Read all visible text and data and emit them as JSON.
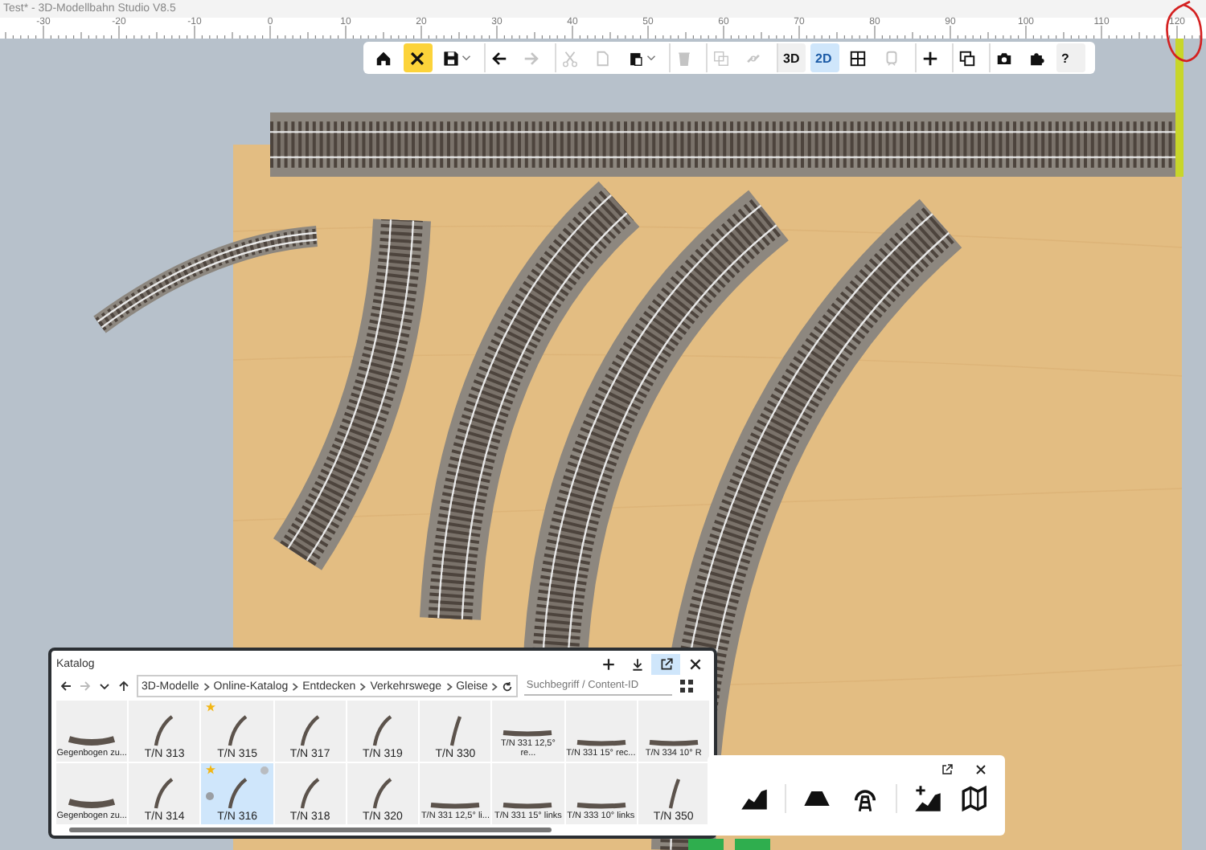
{
  "window": {
    "title": "Test* - 3D-Modellbahn Studio V8.5"
  },
  "ruler": {
    "labels": [
      "-30",
      "-20",
      "-10",
      "0",
      "10",
      "20",
      "30",
      "40",
      "50",
      "60",
      "70",
      "80",
      "90",
      "100",
      "110",
      "120"
    ]
  },
  "toolbar": [
    {
      "kind": "home",
      "selected": false,
      "disabled": false,
      "dropdown": false,
      "separator": false
    },
    {
      "kind": "tools",
      "selected": true,
      "disabled": false,
      "dropdown": false,
      "separator": false
    },
    {
      "kind": "save",
      "selected": false,
      "disabled": false,
      "dropdown": true,
      "separator": false
    },
    {
      "kind": "undo",
      "selected": false,
      "disabled": false,
      "dropdown": false,
      "separator": true
    },
    {
      "kind": "redo",
      "selected": false,
      "disabled": true,
      "dropdown": false,
      "separator": false
    },
    {
      "kind": "cut",
      "selected": false,
      "disabled": true,
      "dropdown": false,
      "separator": true
    },
    {
      "kind": "copy",
      "selected": false,
      "disabled": true,
      "dropdown": false,
      "separator": false
    },
    {
      "kind": "paste",
      "selected": false,
      "disabled": false,
      "dropdown": true,
      "separator": false
    },
    {
      "kind": "delete",
      "selected": false,
      "disabled": true,
      "dropdown": false,
      "separator": true
    },
    {
      "kind": "group",
      "selected": false,
      "disabled": true,
      "dropdown": false,
      "separator": true
    },
    {
      "kind": "link",
      "selected": false,
      "disabled": true,
      "dropdown": false,
      "separator": false
    },
    {
      "kind": "text",
      "label": "3D",
      "selected": false,
      "disabled": false,
      "dropdown": false,
      "separator": true
    },
    {
      "kind": "text",
      "label": "2D",
      "selected": true,
      "disabled": false,
      "dropdown": false,
      "separator": false
    },
    {
      "kind": "grid",
      "selected": false,
      "disabled": false,
      "dropdown": false,
      "separator": false
    },
    {
      "kind": "train",
      "selected": false,
      "disabled": true,
      "dropdown": false,
      "separator": false
    },
    {
      "kind": "plus",
      "selected": false,
      "disabled": false,
      "dropdown": false,
      "separator": true
    },
    {
      "kind": "windows",
      "selected": false,
      "disabled": false,
      "dropdown": false,
      "separator": true
    },
    {
      "kind": "camera",
      "selected": false,
      "disabled": false,
      "dropdown": false,
      "separator": true
    },
    {
      "kind": "puzzle",
      "selected": false,
      "disabled": false,
      "dropdown": false,
      "separator": false
    },
    {
      "kind": "text",
      "label": "?",
      "selected": false,
      "disabled": false,
      "dropdown": false,
      "separator": false
    }
  ],
  "catalog": {
    "title": "Katalog",
    "header_buttons": [
      {
        "kind": "plus",
        "selected": false
      },
      {
        "kind": "download",
        "selected": false
      },
      {
        "kind": "popout",
        "selected": true
      },
      {
        "kind": "close",
        "selected": false
      }
    ],
    "nav": [
      {
        "kind": "back",
        "disabled": false
      },
      {
        "kind": "forward",
        "disabled": true
      },
      {
        "kind": "down",
        "disabled": false
      },
      {
        "kind": "up",
        "disabled": false
      }
    ],
    "breadcrumb": [
      "3D-Modelle",
      "Online-Katalog",
      "Entdecken",
      "Verkehrswege",
      "Gleise"
    ],
    "search": {
      "placeholder": "Suchbegriff / Content-ID"
    },
    "items": [
      {
        "label": "Gegenbogen zu...",
        "kind": "wide",
        "selected": false,
        "favorite": false,
        "markers": false
      },
      {
        "label": "T/N 313",
        "kind": "curve",
        "selected": false,
        "favorite": false,
        "markers": false
      },
      {
        "label": "T/N 315",
        "kind": "curve",
        "selected": false,
        "favorite": true,
        "markers": false
      },
      {
        "label": "T/N 317",
        "kind": "curve",
        "selected": false,
        "favorite": false,
        "markers": false
      },
      {
        "label": "T/N 319",
        "kind": "curve",
        "selected": false,
        "favorite": false,
        "markers": false
      },
      {
        "label": "T/N 330",
        "kind": "steep",
        "selected": false,
        "favorite": false,
        "markers": false
      },
      {
        "label": "T/N 331 12,5° re...",
        "kind": "flat",
        "selected": false,
        "favorite": false,
        "markers": false
      },
      {
        "label": "T/N 331 15° rec...",
        "kind": "flat",
        "selected": false,
        "favorite": false,
        "markers": false
      },
      {
        "label": "T/N 334 10° R",
        "kind": "flat",
        "selected": false,
        "favorite": false,
        "markers": false
      },
      {
        "label": "Gegenbogen zu...",
        "kind": "wide",
        "selected": false,
        "favorite": false,
        "markers": false
      },
      {
        "label": "T/N 314",
        "kind": "curve",
        "selected": false,
        "favorite": false,
        "markers": false
      },
      {
        "label": "T/N 316",
        "kind": "curve",
        "selected": true,
        "favorite": true,
        "markers": true
      },
      {
        "label": "T/N 318",
        "kind": "curve",
        "selected": false,
        "favorite": false,
        "markers": false
      },
      {
        "label": "T/N 320",
        "kind": "curve",
        "selected": false,
        "favorite": false,
        "markers": false
      },
      {
        "label": "T/N 331 12,5° li...",
        "kind": "flat",
        "selected": false,
        "favorite": false,
        "markers": false
      },
      {
        "label": "T/N 331 15° links",
        "kind": "flat",
        "selected": false,
        "favorite": false,
        "markers": false
      },
      {
        "label": "T/N 333 10° links",
        "kind": "flat",
        "selected": false,
        "favorite": false,
        "markers": false
      },
      {
        "label": "T/N 350",
        "kind": "steep",
        "selected": false,
        "favorite": false,
        "markers": false
      }
    ]
  },
  "terrain_panel": {
    "header_buttons": [
      {
        "kind": "popout"
      },
      {
        "kind": "close"
      }
    ],
    "tools": [
      {
        "kind": "raise",
        "separator": false
      },
      {
        "kind": "plateau",
        "separator": true
      },
      {
        "kind": "tunnel",
        "separator": false
      },
      {
        "kind": "add-terrain",
        "separator": true
      },
      {
        "kind": "map",
        "separator": false
      }
    ]
  }
}
